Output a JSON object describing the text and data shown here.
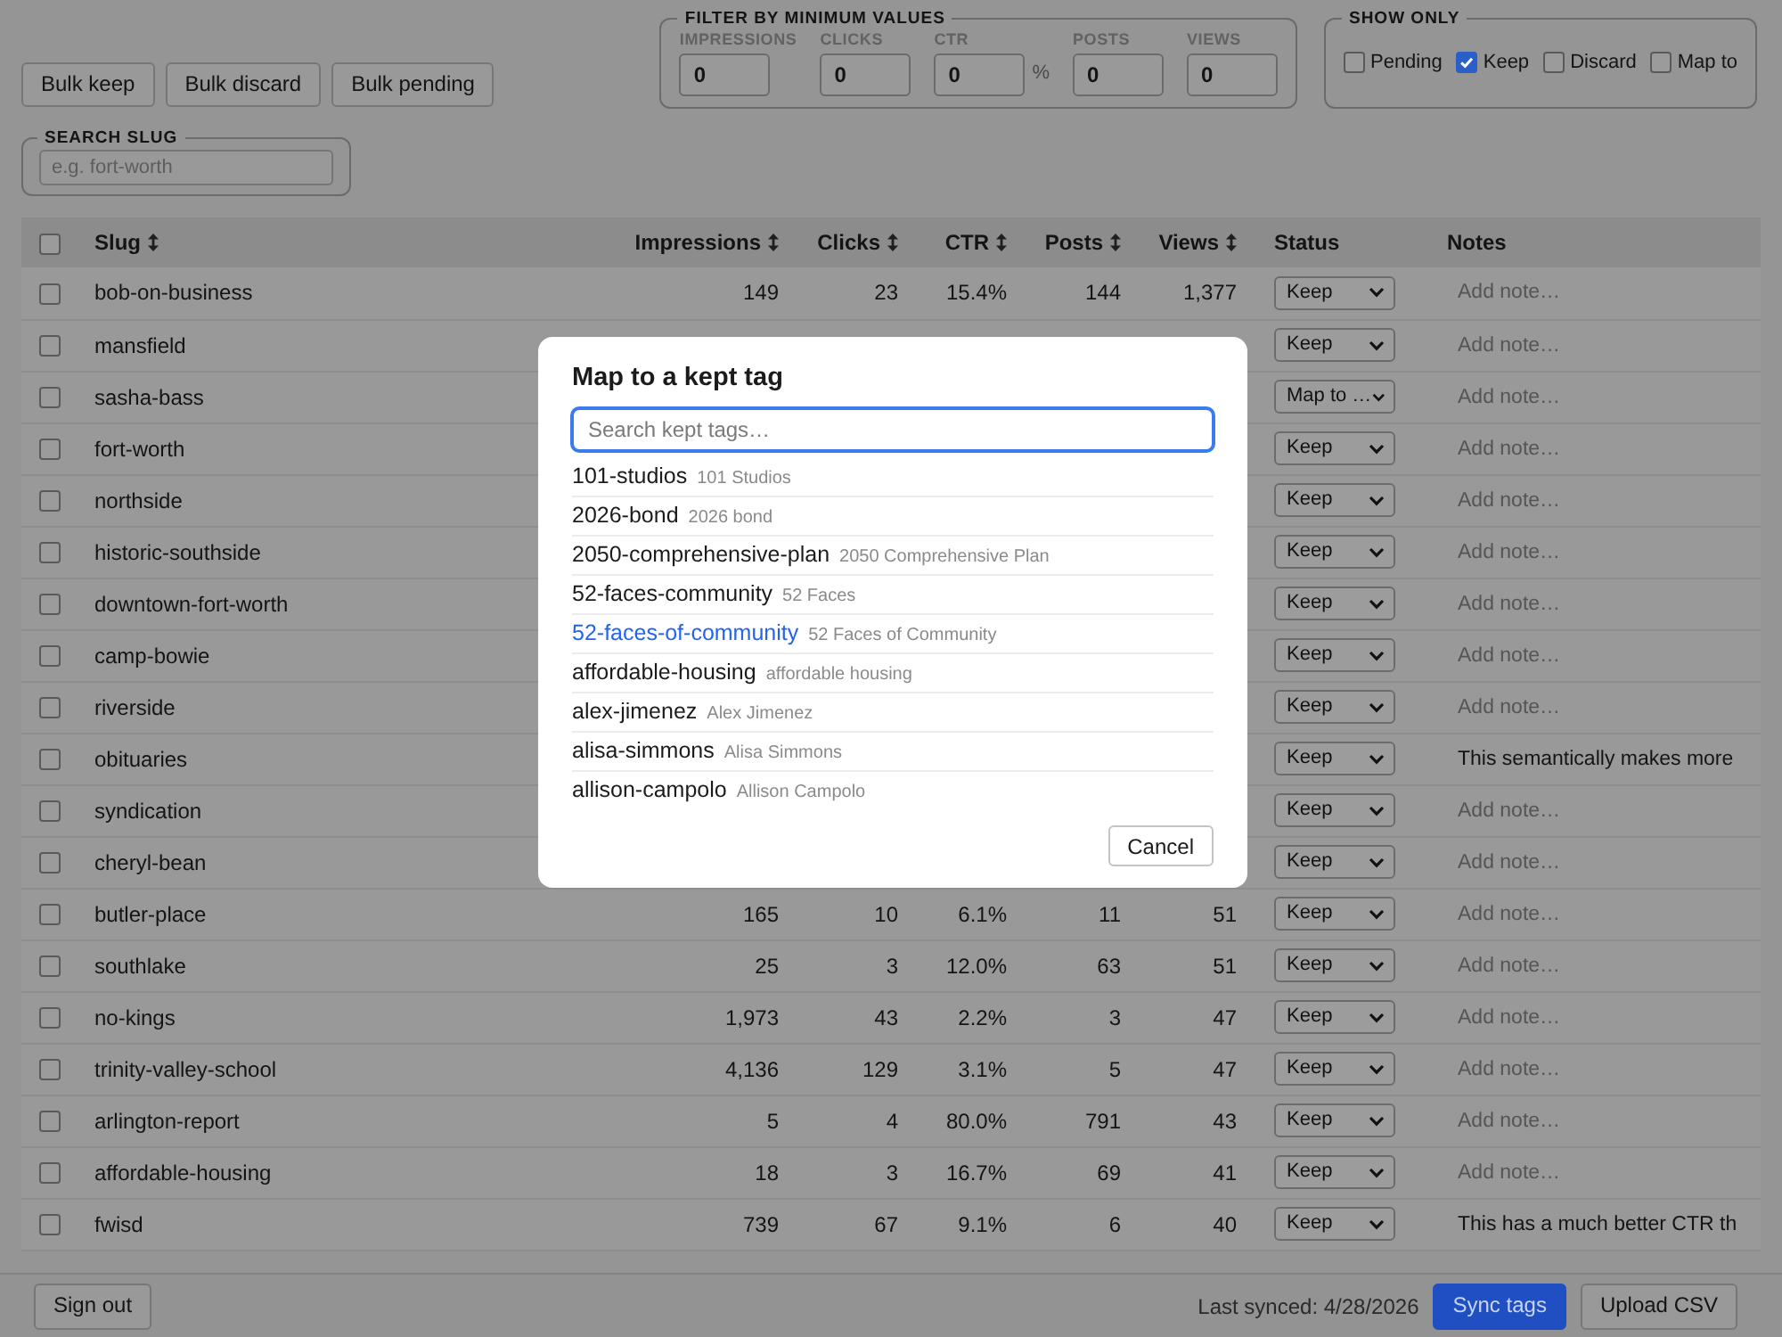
{
  "toolbar": {
    "bulk_buttons": [
      "Bulk keep",
      "Bulk discard",
      "Bulk pending"
    ]
  },
  "filter": {
    "legend": "FILTER BY MINIMUM VALUES",
    "fields": [
      {
        "label": "IMPRESSIONS",
        "value": "0"
      },
      {
        "label": "CLICKS",
        "value": "0"
      },
      {
        "label": "CTR",
        "value": "0",
        "unit": "%"
      },
      {
        "label": "POSTS",
        "value": "0"
      },
      {
        "label": "VIEWS",
        "value": "0"
      }
    ]
  },
  "show_only": {
    "legend": "SHOW ONLY",
    "options": [
      {
        "label": "Pending",
        "checked": false
      },
      {
        "label": "Keep",
        "checked": true
      },
      {
        "label": "Discard",
        "checked": false
      },
      {
        "label": "Map to",
        "checked": false
      }
    ]
  },
  "search": {
    "legend": "SEARCH SLUG",
    "placeholder": "e.g. fort-worth"
  },
  "table": {
    "select_all": {
      "checked": false
    },
    "columns": [
      {
        "label": "Slug",
        "kind": "slug",
        "sortable": true
      },
      {
        "label": "Impressions",
        "kind": "metric",
        "sortable": true
      },
      {
        "label": "Clicks",
        "kind": "metric",
        "sortable": true
      },
      {
        "label": "CTR",
        "kind": "metric",
        "sortable": true
      },
      {
        "label": "Posts",
        "kind": "metric",
        "sortable": true
      },
      {
        "label": "Views",
        "kind": "metric",
        "sortable": true
      },
      {
        "label": "Status",
        "kind": "status",
        "sortable": false
      },
      {
        "label": "Notes",
        "kind": "notes",
        "sortable": false
      }
    ],
    "rows": [
      {
        "checked": false,
        "slug": "bob-on-business",
        "metrics": [
          "149",
          "23",
          "15.4%",
          "144",
          "1,377"
        ],
        "status": "Keep",
        "note": {
          "placeholder": "Add note…"
        }
      },
      {
        "checked": false,
        "slug": "mansfield",
        "status": "Keep",
        "note": {
          "placeholder": "Add note…"
        }
      },
      {
        "checked": false,
        "slug": "sasha-bass",
        "status": "Map to …",
        "note": {
          "placeholder": "Add note…"
        }
      },
      {
        "checked": false,
        "slug": "fort-worth",
        "status": "Keep",
        "note": {
          "placeholder": "Add note…"
        }
      },
      {
        "checked": false,
        "slug": "northside",
        "status": "Keep",
        "note": {
          "placeholder": "Add note…"
        }
      },
      {
        "checked": false,
        "slug": "historic-southside",
        "status": "Keep",
        "note": {
          "placeholder": "Add note…"
        }
      },
      {
        "checked": false,
        "slug": "downtown-fort-worth",
        "status": "Keep",
        "note": {
          "placeholder": "Add note…"
        }
      },
      {
        "checked": false,
        "slug": "camp-bowie",
        "status": "Keep",
        "note": {
          "placeholder": "Add note…"
        }
      },
      {
        "checked": false,
        "slug": "riverside",
        "status": "Keep",
        "note": {
          "placeholder": "Add note…"
        }
      },
      {
        "checked": false,
        "slug": "obituaries",
        "status": "Keep",
        "note": {
          "value": "This semantically makes more"
        }
      },
      {
        "checked": false,
        "slug": "syndication",
        "status": "Keep",
        "note": {
          "placeholder": "Add note…"
        }
      },
      {
        "checked": false,
        "slug": "cheryl-bean",
        "status": "Keep",
        "note": {
          "placeholder": "Add note…"
        }
      },
      {
        "checked": false,
        "slug": "butler-place",
        "metrics": [
          "165",
          "10",
          "6.1%",
          "11",
          "51"
        ],
        "status": "Keep",
        "note": {
          "placeholder": "Add note…"
        }
      },
      {
        "checked": false,
        "slug": "southlake",
        "metrics": [
          "25",
          "3",
          "12.0%",
          "63",
          "51"
        ],
        "status": "Keep",
        "note": {
          "placeholder": "Add note…"
        }
      },
      {
        "checked": false,
        "slug": "no-kings",
        "metrics": [
          "1,973",
          "43",
          "2.2%",
          "3",
          "47"
        ],
        "status": "Keep",
        "note": {
          "placeholder": "Add note…"
        }
      },
      {
        "checked": false,
        "slug": "trinity-valley-school",
        "metrics": [
          "4,136",
          "129",
          "3.1%",
          "5",
          "47"
        ],
        "status": "Keep",
        "note": {
          "placeholder": "Add note…"
        }
      },
      {
        "checked": false,
        "slug": "arlington-report",
        "metrics": [
          "5",
          "4",
          "80.0%",
          "791",
          "43"
        ],
        "status": "Keep",
        "note": {
          "placeholder": "Add note…"
        }
      },
      {
        "checked": false,
        "slug": "affordable-housing",
        "metrics": [
          "18",
          "3",
          "16.7%",
          "69",
          "41"
        ],
        "status": "Keep",
        "note": {
          "placeholder": "Add note…"
        }
      },
      {
        "checked": false,
        "slug": "fwisd",
        "metrics": [
          "739",
          "67",
          "9.1%",
          "6",
          "40"
        ],
        "status": "Keep",
        "note": {
          "value": "This has a much better CTR th"
        }
      }
    ]
  },
  "modal": {
    "title": "Map to a kept tag",
    "search": {
      "placeholder": "Search kept tags…",
      "focused": true
    },
    "options": [
      {
        "slug": "101-studios",
        "name": "101 Studios",
        "selected": false
      },
      {
        "slug": "2026-bond",
        "name": "2026 bond",
        "selected": false
      },
      {
        "slug": "2050-comprehensive-plan",
        "name": "2050 Comprehensive Plan",
        "selected": false
      },
      {
        "slug": "52-faces-community",
        "name": "52 Faces",
        "selected": false
      },
      {
        "slug": "52-faces-of-community",
        "name": "52 Faces of Community",
        "selected": true
      },
      {
        "slug": "affordable-housing",
        "name": "affordable housing",
        "selected": false
      },
      {
        "slug": "alex-jimenez",
        "name": "Alex Jimenez",
        "selected": false
      },
      {
        "slug": "alisa-simmons",
        "name": "Alisa Simmons",
        "selected": false
      },
      {
        "slug": "allison-campolo",
        "name": "Allison Campolo",
        "selected": false
      }
    ],
    "cancel": "Cancel"
  },
  "status_bar": {
    "sign_out": "Sign out",
    "last_synced": "Last synced: 4/28/2026",
    "buttons": [
      {
        "label": "Sync tags",
        "kind": "primary"
      },
      {
        "label": "Upload CSV",
        "kind": "secondary"
      }
    ]
  }
}
